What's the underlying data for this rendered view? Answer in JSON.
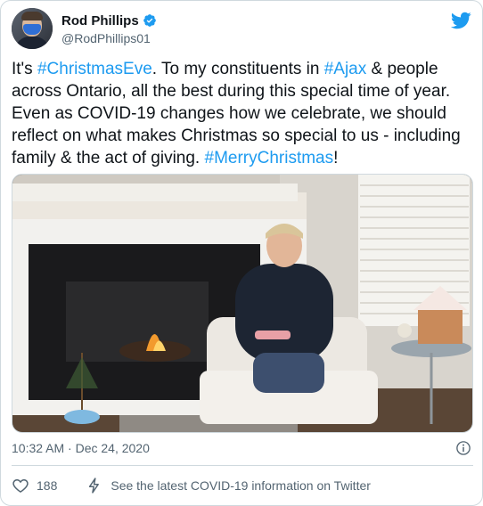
{
  "author": {
    "display_name": "Rod Phillips",
    "handle": "@RodPhillips01",
    "verified_icon": "verified-badge-icon",
    "avatar": "profile-photo-avatar"
  },
  "brand": {
    "icon": "twitter-bird-icon",
    "color": "#1d9bf0"
  },
  "tweet": {
    "segments": [
      {
        "text": "It's ",
        "tag": false
      },
      {
        "text": "#ChristmasEve",
        "tag": true
      },
      {
        "text": ". To my constituents in ",
        "tag": false
      },
      {
        "text": "#Ajax",
        "tag": true
      },
      {
        "text": " & people across Ontario, all the best during this special time of year. Even as COVID-19 changes how we celebrate, we should reflect on what makes Christmas so special to us - including family & the act of giving. ",
        "tag": false
      },
      {
        "text": "#MerryChristmas",
        "tag": true
      },
      {
        "text": "!",
        "tag": false
      }
    ]
  },
  "media": {
    "kind": "video-thumbnail"
  },
  "timestamp": "10:32 AM · Dec 24, 2020",
  "actions": {
    "like_icon": "heart-icon",
    "like_count": "188",
    "covid_icon": "lightning-bolt-icon",
    "covid_label": "See the latest COVID-19 information on Twitter"
  },
  "colors": {
    "text": "#0f1419",
    "secondary": "#536471",
    "hashtag": "#1d9bf0",
    "border": "#cfd9de"
  }
}
